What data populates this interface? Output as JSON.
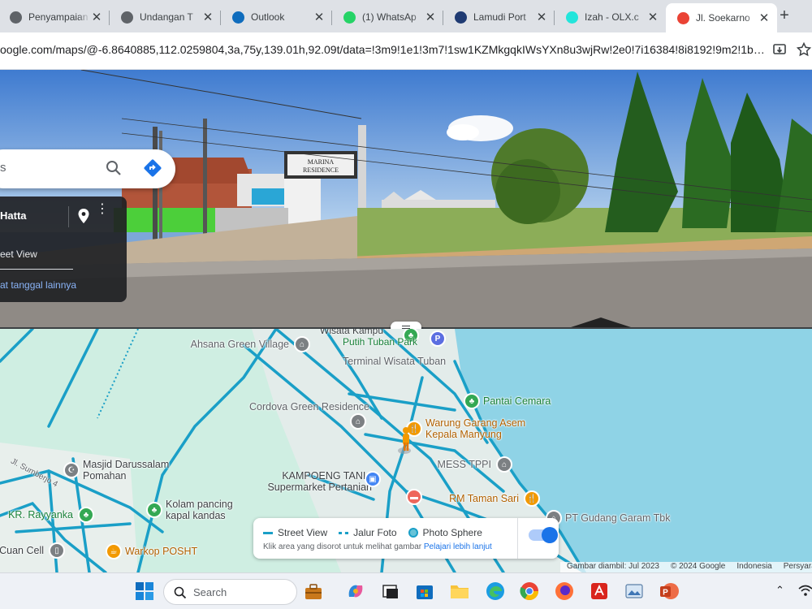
{
  "browser": {
    "tabs": [
      {
        "label": "Penyampaian",
        "favicon_color": "#5f6368",
        "favicon": "globe-icon"
      },
      {
        "label": "Undangan T",
        "favicon_color": "#5f6368",
        "favicon": "globe-icon"
      },
      {
        "label": "Outlook",
        "favicon_color": "#0f6cbd",
        "favicon": "outlook-icon"
      },
      {
        "label": "(1) WhatsAp",
        "favicon_color": "#25d366",
        "favicon": "whatsapp-icon"
      },
      {
        "label": "Lamudi Port",
        "favicon_color": "#1f3b73",
        "favicon": "lamudi-icon"
      },
      {
        "label": "Izah - OLX.c",
        "favicon_color": "#23e5db",
        "favicon": "olx-icon"
      },
      {
        "label": "Jl. Soekarno",
        "favicon_color": "#ea4335",
        "favicon": "maps-icon",
        "active": true
      }
    ],
    "new_tab_symbol": "+",
    "close_symbol": "✕",
    "url": "oogle.com/maps/@-6.8640885,112.0259804,3a,75y,139.01h,92.09t/data=!3m9!1e1!3m7!1sw1KZMkgqkIWsYXn8u3wjRw!2e0!7i16384!8i8192!9m2!1b1!2i48?e..."
  },
  "streetview": {
    "search_query": "s",
    "sign_text_1": "MARINA",
    "sign_text_2": "RESIDENCE",
    "card": {
      "title": "Hatta",
      "subtitle": "eet View",
      "link": "at tanggal lainnya"
    }
  },
  "map": {
    "pois": [
      {
        "name": "Ahsana Green Village",
        "kind": "gray"
      },
      {
        "name": "Putih Tuban Park",
        "kind": "green"
      },
      {
        "name": "Terminal Wisata Tuban",
        "kind": "label"
      },
      {
        "name": "Cordova Green Residence",
        "kind": "gray"
      },
      {
        "name": "Pantai Cemara",
        "kind": "green"
      },
      {
        "name": "Warung Garang Asem Kepala Manyung",
        "kind": "orange"
      },
      {
        "name": "MESS TPPI",
        "kind": "gray"
      },
      {
        "name": "Masjid Darussalam Pomahan",
        "kind": "gray"
      },
      {
        "name": "KAMPOENG TANI - Supermarket Pertanian",
        "kind": "blue"
      },
      {
        "name": "Kolam pancing kapal kandas",
        "kind": "green"
      },
      {
        "name": "RM Taman Sari",
        "kind": "orange"
      },
      {
        "name": "PT Gudang Garam Tbk",
        "kind": "gray"
      },
      {
        "name": "KR. Rayyanka",
        "kind": "green"
      },
      {
        "name": "Cuan Cell",
        "kind": "gray"
      },
      {
        "name": "Warkop POSHT",
        "kind": "orange"
      }
    ],
    "road_label": "Jl. Sumberjo 4",
    "top_cut_label": "Wisata Kampu",
    "legend": {
      "street_view": "Street View",
      "jalur_foto": "Jalur Foto",
      "photo_sphere": "Photo Sphere",
      "hint": "Klik area yang disorot untuk melihat gambar",
      "learn_more": "Pelajari lebih lanjut",
      "toggle_on": true
    },
    "attribution": {
      "captured": "Gambar diambil: Jul 2023",
      "copyright": "© 2024 Google",
      "region": "Indonesia",
      "terms": "Persyara"
    }
  },
  "taskbar": {
    "search_placeholder": "Search"
  }
}
